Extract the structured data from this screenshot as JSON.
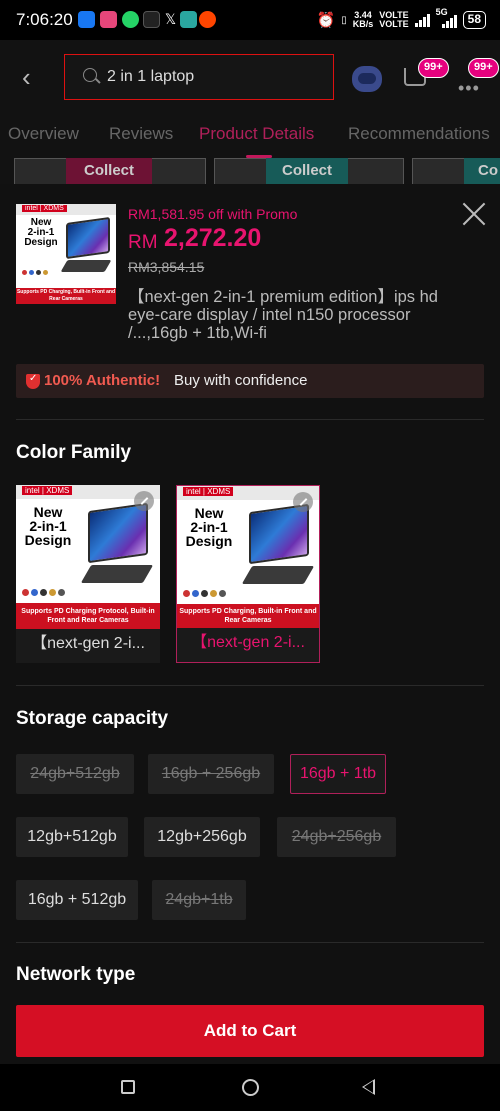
{
  "status_bar": {
    "time": "7:06:20",
    "net_speed_value": "3.44",
    "net_speed_unit": "KB/s",
    "volte1": "VOLTE",
    "volte2": "VOLTE",
    "signal_label": "5G",
    "battery": "58"
  },
  "header": {
    "search_value": "2 in 1 laptop",
    "cart_badge": "99+",
    "more_badge": "99+"
  },
  "tabs": [
    {
      "label": "Overview"
    },
    {
      "label": "Reviews"
    },
    {
      "label": "Product Details"
    },
    {
      "label": "Recommendations"
    }
  ],
  "collect_strip": [
    {
      "label": "Collect"
    },
    {
      "label": "Collect"
    },
    {
      "label": "Co"
    }
  ],
  "product": {
    "promo_text": "RM1,581.95 off with Promo",
    "currency": "RM",
    "price": "2,272.20",
    "old_price": "RM3,854.15",
    "name": "【next-gen 2-in-1 premium edition】ips hd eye-care display / intel n150 processor /...,16gb + 1tb,Wi-fi"
  },
  "thumbnail": {
    "brand_bar": "intel | XDMS",
    "title_line1": "New",
    "title_line2": "2-in-1",
    "title_line3": "Design",
    "banner_short": "Supports PD Charging, Built-in Front and Rear Cameras",
    "banner_long": "Supports PD Charging Protocol, Built-in Front and Rear Cameras"
  },
  "authentic": {
    "highlight": "100% Authentic!",
    "text": "Buy with confidence"
  },
  "color_family": {
    "title": "Color Family",
    "variants": [
      {
        "label": "【next-gen 2-i...",
        "selected": false
      },
      {
        "label": "【next-gen 2-i...",
        "selected": true
      }
    ]
  },
  "storage": {
    "title": "Storage capacity",
    "options": [
      {
        "label": "24gb+512gb",
        "state": "disabled"
      },
      {
        "label": "16gb + 256gb",
        "state": "disabled"
      },
      {
        "label": "16gb + 1tb",
        "state": "selected"
      },
      {
        "label": "12gb+512gb",
        "state": "available"
      },
      {
        "label": "12gb+256gb",
        "state": "available"
      },
      {
        "label": "24gb+256gb",
        "state": "disabled"
      },
      {
        "label": "16gb + 512gb",
        "state": "available"
      },
      {
        "label": "24gb+1tb",
        "state": "disabled"
      }
    ]
  },
  "network": {
    "title": "Network type"
  },
  "actions": {
    "add_to_cart": "Add to Cart"
  },
  "colors": {
    "accent_pink": "#e8146f",
    "cart_red": "#d50f24",
    "selected_border": "#b0205a"
  },
  "icons": [
    "back-arrow-icon",
    "search-icon",
    "assistant-robot-icon",
    "cart-icon",
    "more-icon",
    "close-icon",
    "shield-check-icon",
    "zoom-icon",
    "nav-recents-icon",
    "nav-home-icon",
    "nav-back-icon"
  ]
}
